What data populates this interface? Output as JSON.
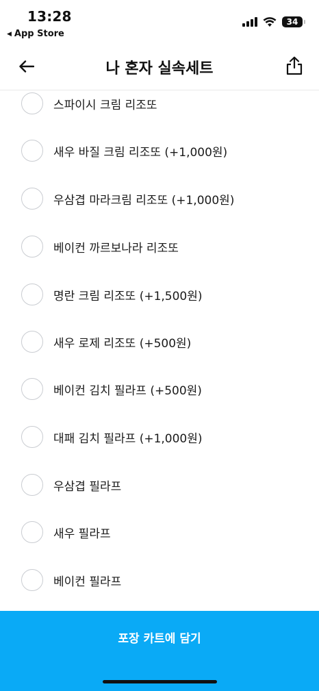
{
  "status_bar": {
    "time": "13:28",
    "back_label": "App Store",
    "battery": "34"
  },
  "header": {
    "title": "나 혼자 실속세트"
  },
  "options": [
    {
      "label": "스파이시 크림 리조또"
    },
    {
      "label": "새우 바질 크림 리조또 (+1,000원)"
    },
    {
      "label": "우삼겹 마라크림 리조또 (+1,000원)"
    },
    {
      "label": "베이컨 까르보나라 리조또"
    },
    {
      "label": "명란 크림 리조또 (+1,500원)"
    },
    {
      "label": "새우 로제 리조또 (+500원)"
    },
    {
      "label": "베이컨 김치 필라프 (+500원)"
    },
    {
      "label": "대패 김치 필라프 (+1,000원)"
    },
    {
      "label": "우삼겹 필라프"
    },
    {
      "label": "새우 필라프"
    },
    {
      "label": "베이컨 필라프"
    }
  ],
  "cta": {
    "label": "포장 카트에 담기"
  },
  "colors": {
    "accent": "#0aaaf6",
    "radio_border": "#c9ccd1"
  },
  "icons": {
    "back": "arrow-left-icon",
    "share": "share-icon",
    "signal": "signal-icon",
    "wifi": "wifi-icon",
    "battery": "battery-icon"
  }
}
